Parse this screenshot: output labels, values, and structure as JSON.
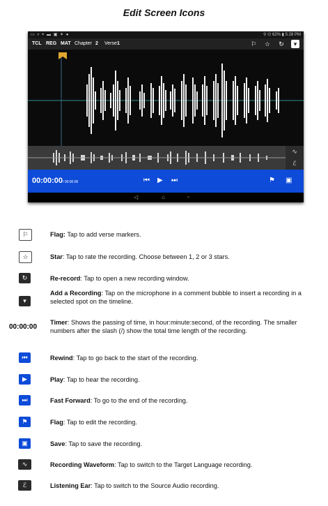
{
  "title": "Edit Screen Icons",
  "device": {
    "status_left": "▭ ▿ ⌖ ▬ ▣ ✶ ●",
    "status_right": "⚲ ⌬ 62% ▮ 5:28 PM",
    "toolbar": {
      "tcl": "TCL",
      "reg": "REG",
      "mat": "MAT",
      "chapter_label": "Chapter",
      "chapter_value": "2",
      "verse_label": "Verse",
      "verse_value": "1"
    },
    "timer_main": "00:00:00",
    "timer_total": "/ 00:00:00"
  },
  "legend": [
    {
      "label": "Flag:",
      "text": " Tap to add verse markers."
    },
    {
      "label": "Star",
      "text": ": Tap to rate the recording. Choose between 1, 2 or 3 stars."
    },
    {
      "label": "Re-record",
      "text": ": Tap to open a new recording window."
    },
    {
      "label": "Add a Recording",
      "text": ": Tap on the microphone in a comment bubble to insert a recording in a selected spot on the timeline."
    },
    {
      "label": "Timer",
      "text": ": Shows the passing of time, in hour:minute:second, of the recording. The smaller numbers after the slash (/) show the total time length of the recording.",
      "icon_text": "00:00:00"
    },
    {
      "label": "Rewind",
      "text": ": Tap to go back to the start of the recording."
    },
    {
      "label": "Play",
      "text": ": Tap to hear the recording."
    },
    {
      "label": "Fast Forward",
      "text": ": To go to the end of the recording."
    },
    {
      "label": "Flag",
      "text": ": Tap to edit the recording."
    },
    {
      "label": "Save",
      "text": ": Tap to save the recording."
    },
    {
      "label": "Recording Waveform",
      "text": ": Tap to switch to the Target Language recording."
    },
    {
      "label": "Listening Ear",
      "text": ": Tap to switch to the Source Audio recording."
    }
  ]
}
